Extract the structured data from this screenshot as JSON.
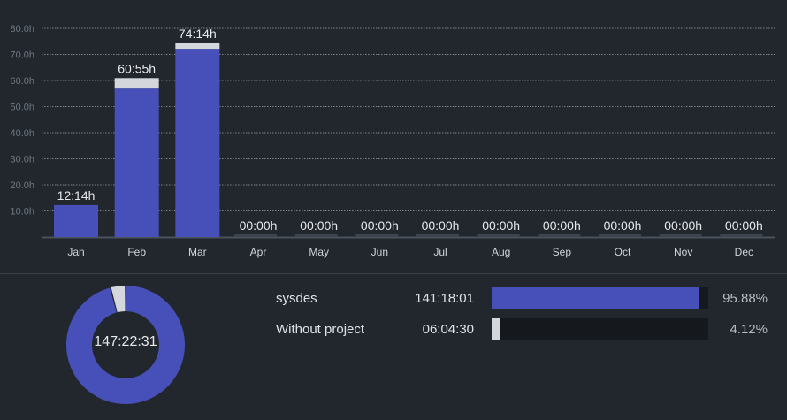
{
  "colors": {
    "background": "#22272e",
    "project": "#4750b8",
    "without_project": "#d4d7dc",
    "gridline": "#7a828c",
    "track": "#15181c"
  },
  "chart_data": [
    {
      "type": "bar",
      "stacked": true,
      "ylim": [
        0,
        80
      ],
      "y_tick_labels": [
        "10.0h",
        "20.0h",
        "30.0h",
        "40.0h",
        "50.0h",
        "60.0h",
        "70.0h",
        "80.0h"
      ],
      "grid": true,
      "categories": [
        "Jan",
        "Feb",
        "Mar",
        "Apr",
        "May",
        "Jun",
        "Jul",
        "Aug",
        "Sep",
        "Oct",
        "Nov",
        "Dec"
      ],
      "series": [
        {
          "name": "sysdes",
          "values": [
            12.23,
            56.9,
            72.17,
            0,
            0,
            0,
            0,
            0,
            0,
            0,
            0,
            0
          ]
        },
        {
          "name": "Without project",
          "values": [
            0,
            4.02,
            2.07,
            0,
            0,
            0,
            0,
            0,
            0,
            0,
            0,
            0
          ]
        }
      ],
      "data_labels": [
        "12:14h",
        "60:55h",
        "74:14h",
        "00:00h",
        "00:00h",
        "00:00h",
        "00:00h",
        "00:00h",
        "00:00h",
        "00:00h",
        "00:00h",
        "00:00h"
      ]
    },
    {
      "type": "pie",
      "center_label": "147:22:31",
      "slices": [
        {
          "label": "sysdes",
          "value": 95.88
        },
        {
          "label": "Without project",
          "value": 4.12
        }
      ]
    }
  ],
  "projects": [
    {
      "name": "sysdes",
      "time": "141:18:01",
      "percent_label": "95.88%",
      "percent": 95.88
    },
    {
      "name": "Without project",
      "time": "06:04:30",
      "percent_label": "4.12%",
      "percent": 4.12
    }
  ]
}
